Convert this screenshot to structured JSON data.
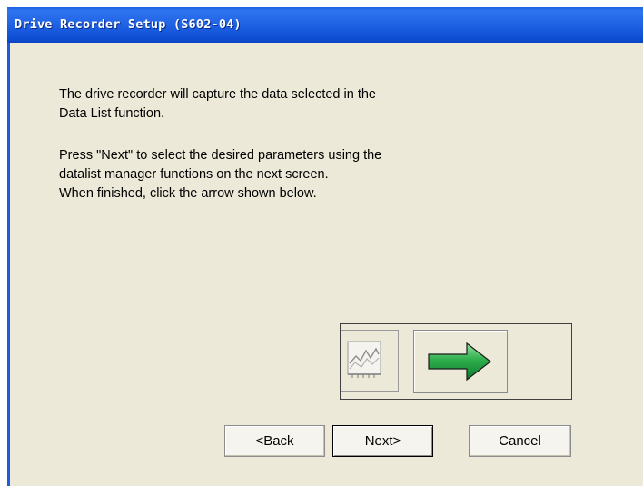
{
  "window": {
    "title": "Drive Recorder Setup (S602-04)"
  },
  "body": {
    "paragraph1": [
      "The drive recorder will capture the data selected in the",
      "Data List function."
    ],
    "paragraph2": [
      "Press \"Next\" to select the desired parameters using the",
      "datalist manager functions on the next screen.",
      "When finished, click the arrow shown below."
    ]
  },
  "figure": {
    "icons": [
      "chart-icon",
      "right-arrow-icon"
    ],
    "arrow_color": "#2fae4e"
  },
  "buttons": {
    "back_label": "<Back",
    "next_label": "Next>",
    "cancel_label": "Cancel"
  },
  "colors": {
    "title_bar": "#1f62e3",
    "dialog_background": "#ece9d8",
    "title_text": "#ffffff"
  }
}
